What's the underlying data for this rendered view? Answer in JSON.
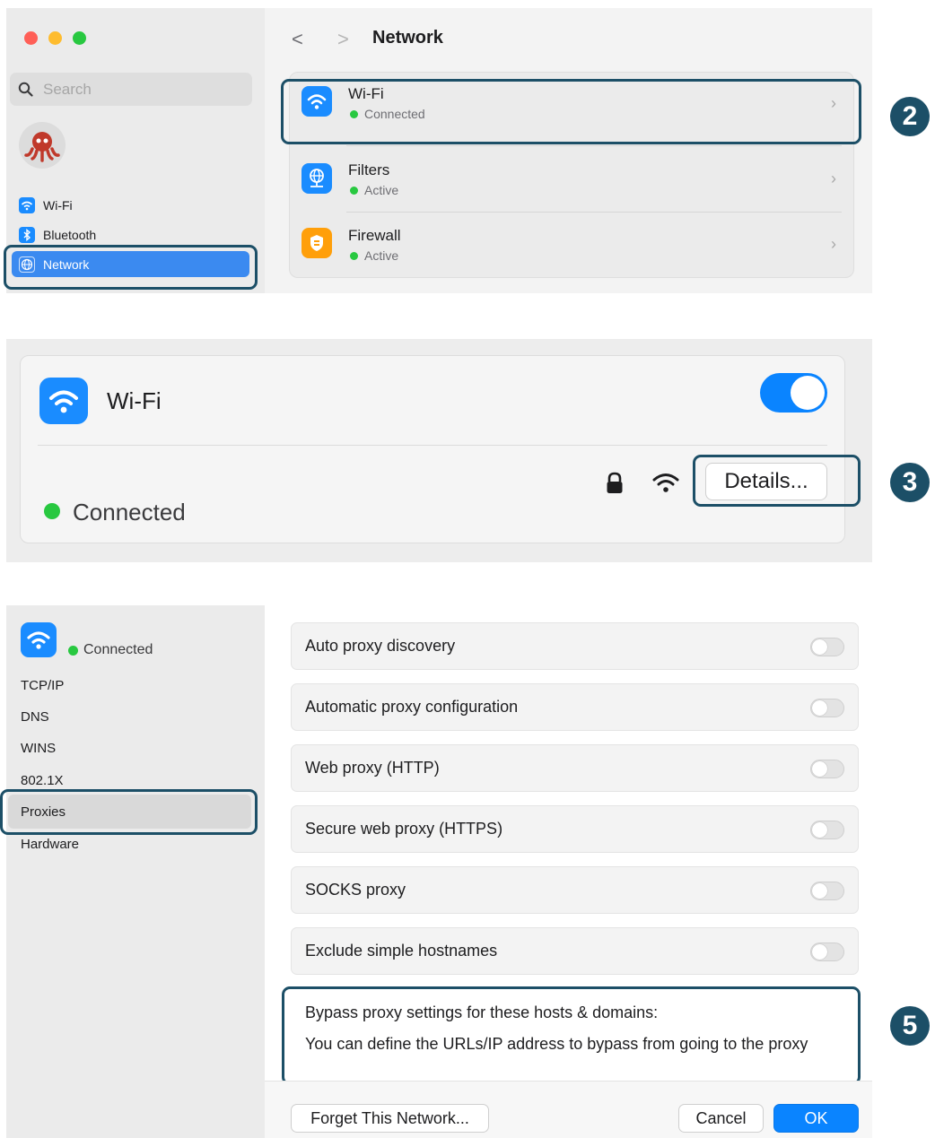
{
  "colors": {
    "accent": "#0a84ff",
    "highlight_border": "#1c4f67",
    "status_green": "#28c840",
    "traffic_red": "#ff5f57",
    "traffic_yellow": "#febc2e",
    "traffic_green": "#28c840"
  },
  "panel1": {
    "search_placeholder": "Search",
    "sidebar": {
      "items": [
        {
          "label": "Wi-Fi",
          "icon": "wifi-icon"
        },
        {
          "label": "Bluetooth",
          "icon": "bluetooth-icon"
        },
        {
          "label": "Network",
          "icon": "globe-icon",
          "selected": true
        }
      ]
    },
    "title": "Network",
    "back_arrow": "<",
    "forward_arrow": ">",
    "rows": [
      {
        "title": "Wi-Fi",
        "status": "Connected",
        "icon": "wifi-icon"
      },
      {
        "title": "Filters",
        "status": "Active",
        "icon": "globe-network-icon"
      },
      {
        "title": "Firewall",
        "status": "Active",
        "icon": "shield-icon"
      }
    ],
    "badge": "2"
  },
  "panel2": {
    "title": "Wi-Fi",
    "toggle_on": true,
    "details_button": "Details...",
    "status": "Connected",
    "badge": "3"
  },
  "panel3": {
    "status": "Connected",
    "sidebar": {
      "items": [
        "TCP/IP",
        "DNS",
        "WINS",
        "802.1X",
        "Proxies",
        "Hardware"
      ],
      "selected": "Proxies"
    },
    "options": [
      {
        "label": "Auto proxy discovery",
        "on": false
      },
      {
        "label": "Automatic proxy configuration",
        "on": false
      },
      {
        "label": "Web proxy (HTTP)",
        "on": false
      },
      {
        "label": "Secure web proxy (HTTPS)",
        "on": false
      },
      {
        "label": "SOCKS proxy",
        "on": false
      },
      {
        "label": "Exclude simple hostnames",
        "on": false
      }
    ],
    "bypass_title": "Bypass proxy settings for these hosts & domains:",
    "bypass_value": "You can define the URLs/IP address to bypass from going to the proxy",
    "forget_button": "Forget This Network...",
    "cancel_button": "Cancel",
    "ok_button": "OK",
    "badge": "5"
  }
}
